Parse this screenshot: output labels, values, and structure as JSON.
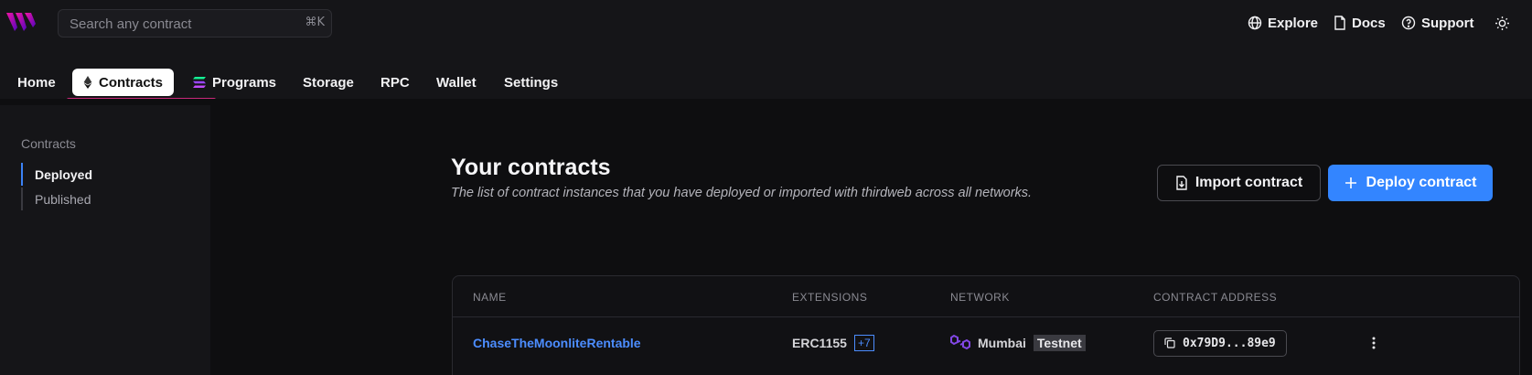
{
  "search": {
    "placeholder": "Search any contract",
    "shortcut": "⌘K"
  },
  "topnav": {
    "explore": "Explore",
    "docs": "Docs",
    "support": "Support"
  },
  "tabs": [
    {
      "label": "Home"
    },
    {
      "label": "Contracts"
    },
    {
      "label": "Programs"
    },
    {
      "label": "Storage"
    },
    {
      "label": "RPC"
    },
    {
      "label": "Wallet"
    },
    {
      "label": "Settings"
    }
  ],
  "sidebar": {
    "title": "Contracts",
    "items": [
      {
        "label": "Deployed"
      },
      {
        "label": "Published"
      }
    ]
  },
  "main": {
    "title": "Your contracts",
    "subtitle": "The list of contract instances that you have deployed or imported with thirdweb across all networks.",
    "import_label": "Import contract",
    "deploy_label": "Deploy contract"
  },
  "table": {
    "headers": {
      "name": "NAME",
      "extensions": "EXTENSIONS",
      "network": "NETWORK",
      "address": "CONTRACT ADDRESS"
    },
    "rows": [
      {
        "name": "ChaseTheMoonliteRentable",
        "extension": "ERC1155",
        "extension_more": "+7",
        "network": "Mumbai",
        "network_tag": "Testnet",
        "address": "0x79D9...89e9"
      }
    ]
  },
  "colors": {
    "accent": "#3385ff",
    "tab_underline": "#c8287a",
    "link": "#4c8dff",
    "polygon": "#8247e5"
  },
  "icons": [
    "thirdweb-logo-icon",
    "globe-icon",
    "file-icon",
    "help-circle-icon",
    "sun-icon",
    "ethereum-icon",
    "solana-icon",
    "file-import-icon",
    "plus-icon",
    "polygon-icon",
    "copy-icon",
    "more-vertical-icon"
  ]
}
